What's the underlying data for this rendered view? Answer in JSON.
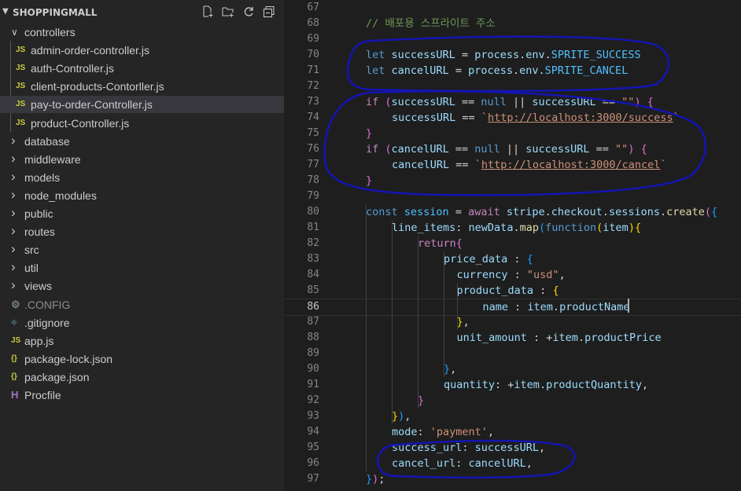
{
  "explorer": {
    "title": "SHOPPINGMALL",
    "header_icons": [
      "new-file-icon",
      "new-folder-icon",
      "refresh-icon",
      "collapse-all-icon"
    ],
    "items": [
      {
        "label": "controllers",
        "kind": "folder-open",
        "depth": 0
      },
      {
        "label": "admin-order-controller.js",
        "kind": "js",
        "depth": 1
      },
      {
        "label": "auth-Controller.js",
        "kind": "js",
        "depth": 1
      },
      {
        "label": "client-products-Contorller.js",
        "kind": "js",
        "depth": 1
      },
      {
        "label": "pay-to-order-Controller.js",
        "kind": "js",
        "depth": 1,
        "selected": true
      },
      {
        "label": "product-Controller.js",
        "kind": "js",
        "depth": 1
      },
      {
        "label": "database",
        "kind": "folder",
        "depth": 0
      },
      {
        "label": "middleware",
        "kind": "folder",
        "depth": 0
      },
      {
        "label": "models",
        "kind": "folder",
        "depth": 0
      },
      {
        "label": "node_modules",
        "kind": "folder",
        "depth": 0
      },
      {
        "label": "public",
        "kind": "folder",
        "depth": 0
      },
      {
        "label": "routes",
        "kind": "folder",
        "depth": 0
      },
      {
        "label": "src",
        "kind": "folder",
        "depth": 0
      },
      {
        "label": "util",
        "kind": "folder",
        "depth": 0
      },
      {
        "label": "views",
        "kind": "folder",
        "depth": 0
      },
      {
        "label": ".CONFIG",
        "kind": "gear",
        "depth": 0,
        "dim": true
      },
      {
        "label": ".gitignore",
        "kind": "git",
        "depth": 0
      },
      {
        "label": "app.js",
        "kind": "js",
        "depth": 0
      },
      {
        "label": "package-lock.json",
        "kind": "json",
        "depth": 0
      },
      {
        "label": "package.json",
        "kind": "json",
        "depth": 0
      },
      {
        "label": "Procfile",
        "kind": "heroku",
        "depth": 0
      }
    ]
  },
  "editor": {
    "current_line": 86,
    "lines": [
      {
        "n": "67",
        "indent": 0,
        "tokens": []
      },
      {
        "n": "68",
        "indent": 1,
        "tokens": [
          [
            "cmt",
            "// 배포용 스프라이트 주소"
          ]
        ]
      },
      {
        "n": "69",
        "indent": 0,
        "tokens": []
      },
      {
        "n": "70",
        "indent": 1,
        "tokens": [
          [
            "kw",
            "let"
          ],
          [
            "pl",
            " "
          ],
          [
            "var",
            "successURL"
          ],
          [
            "pl",
            " = "
          ],
          [
            "var",
            "process"
          ],
          [
            "pl",
            "."
          ],
          [
            "var",
            "env"
          ],
          [
            "pl",
            "."
          ],
          [
            "const",
            "SPRITE_SUCCESS"
          ]
        ]
      },
      {
        "n": "71",
        "indent": 1,
        "tokens": [
          [
            "kw",
            "let"
          ],
          [
            "pl",
            " "
          ],
          [
            "var",
            "cancelURL"
          ],
          [
            "pl",
            " = "
          ],
          [
            "var",
            "process"
          ],
          [
            "pl",
            "."
          ],
          [
            "var",
            "env"
          ],
          [
            "pl",
            "."
          ],
          [
            "const",
            "SPRITE_CANCEL"
          ]
        ]
      },
      {
        "n": "72",
        "indent": 0,
        "tokens": []
      },
      {
        "n": "73",
        "indent": 1,
        "tokens": [
          [
            "kw2",
            "if"
          ],
          [
            "pl",
            " "
          ],
          [
            "br2",
            "("
          ],
          [
            "var",
            "successURL"
          ],
          [
            "pl",
            " == "
          ],
          [
            "kw",
            "null"
          ],
          [
            "pl",
            " || "
          ],
          [
            "var",
            "successURL"
          ],
          [
            "pl",
            " == "
          ],
          [
            "str",
            "\"\""
          ],
          [
            "br2",
            ")"
          ],
          [
            "pl",
            " "
          ],
          [
            "br2",
            "{"
          ]
        ]
      },
      {
        "n": "74",
        "indent": 2,
        "tokens": [
          [
            "var",
            "successURL"
          ],
          [
            "pl",
            " == "
          ],
          [
            "str",
            "`"
          ],
          [
            "url",
            "http://localhost:3000/success"
          ],
          [
            "str",
            "`"
          ]
        ]
      },
      {
        "n": "75",
        "indent": 1,
        "tokens": [
          [
            "br2",
            "}"
          ]
        ]
      },
      {
        "n": "76",
        "indent": 1,
        "tokens": [
          [
            "kw2",
            "if"
          ],
          [
            "pl",
            " "
          ],
          [
            "br2",
            "("
          ],
          [
            "var",
            "cancelURL"
          ],
          [
            "pl",
            " == "
          ],
          [
            "kw",
            "null"
          ],
          [
            "pl",
            " || "
          ],
          [
            "var",
            "successURL"
          ],
          [
            "pl",
            " == "
          ],
          [
            "str",
            "\"\""
          ],
          [
            "br2",
            ")"
          ],
          [
            "pl",
            " "
          ],
          [
            "br2",
            "{"
          ]
        ]
      },
      {
        "n": "77",
        "indent": 2,
        "tokens": [
          [
            "var",
            "cancelURL"
          ],
          [
            "pl",
            " == "
          ],
          [
            "str",
            "`"
          ],
          [
            "url",
            "http://localhost:3000/cancel"
          ],
          [
            "str",
            "`"
          ]
        ]
      },
      {
        "n": "78",
        "indent": 1,
        "tokens": [
          [
            "br2",
            "}"
          ]
        ]
      },
      {
        "n": "79",
        "indent": 0,
        "tokens": []
      },
      {
        "n": "80",
        "indent": 1,
        "tokens": [
          [
            "kw",
            "const"
          ],
          [
            "pl",
            " "
          ],
          [
            "const",
            "session"
          ],
          [
            "pl",
            " = "
          ],
          [
            "kw2",
            "await"
          ],
          [
            "pl",
            " "
          ],
          [
            "var",
            "stripe"
          ],
          [
            "pl",
            "."
          ],
          [
            "var",
            "checkout"
          ],
          [
            "pl",
            "."
          ],
          [
            "var",
            "sessions"
          ],
          [
            "pl",
            "."
          ],
          [
            "fn",
            "create"
          ],
          [
            "br2",
            "("
          ],
          [
            "br3",
            "{"
          ]
        ]
      },
      {
        "n": "81",
        "indent": 2,
        "tokens": [
          [
            "var",
            "line_items"
          ],
          [
            "pl",
            ": "
          ],
          [
            "var",
            "newData"
          ],
          [
            "pl",
            "."
          ],
          [
            "fn",
            "map"
          ],
          [
            "br3",
            "("
          ],
          [
            "kw",
            "function"
          ],
          [
            "br1",
            "("
          ],
          [
            "var",
            "item"
          ],
          [
            "br1",
            ")"
          ],
          [
            "br1",
            "{"
          ]
        ]
      },
      {
        "n": "82",
        "indent": 3,
        "tokens": [
          [
            "kw2",
            "return"
          ],
          [
            "br2",
            "{"
          ]
        ]
      },
      {
        "n": "83",
        "indent": 4,
        "tokens": [
          [
            "var",
            "price_data"
          ],
          [
            "pl",
            " : "
          ],
          [
            "br3",
            "{"
          ]
        ]
      },
      {
        "n": "84",
        "indent": 4.5,
        "tokens": [
          [
            "var",
            "currency"
          ],
          [
            "pl",
            " : "
          ],
          [
            "str",
            "\"usd\""
          ],
          [
            "pl",
            ","
          ]
        ]
      },
      {
        "n": "85",
        "indent": 4.5,
        "tokens": [
          [
            "var",
            "product_data"
          ],
          [
            "pl",
            " : "
          ],
          [
            "br1",
            "{"
          ]
        ]
      },
      {
        "n": "86",
        "indent": 5.5,
        "tokens": [
          [
            "var",
            "name"
          ],
          [
            "pl",
            " : "
          ],
          [
            "var",
            "item"
          ],
          [
            "pl",
            "."
          ],
          [
            "var",
            "productName"
          ]
        ]
      },
      {
        "n": "87",
        "indent": 4.5,
        "tokens": [
          [
            "br1",
            "}"
          ],
          [
            "pl",
            ","
          ]
        ]
      },
      {
        "n": "88",
        "indent": 4.5,
        "tokens": [
          [
            "var",
            "unit_amount"
          ],
          [
            "pl",
            " : +"
          ],
          [
            "var",
            "item"
          ],
          [
            "pl",
            "."
          ],
          [
            "var",
            "productPrice"
          ]
        ]
      },
      {
        "n": "89",
        "indent": 0,
        "tokens": []
      },
      {
        "n": "90",
        "indent": 4,
        "tokens": [
          [
            "br3",
            "}"
          ],
          [
            "pl",
            ","
          ]
        ]
      },
      {
        "n": "91",
        "indent": 4,
        "tokens": [
          [
            "var",
            "quantity"
          ],
          [
            "pl",
            ": +"
          ],
          [
            "var",
            "item"
          ],
          [
            "pl",
            "."
          ],
          [
            "var",
            "productQuantity"
          ],
          [
            "pl",
            ","
          ]
        ]
      },
      {
        "n": "92",
        "indent": 3,
        "tokens": [
          [
            "br2",
            "}"
          ]
        ]
      },
      {
        "n": "93",
        "indent": 2,
        "tokens": [
          [
            "br1",
            "}"
          ],
          [
            "br3",
            ")"
          ],
          [
            "pl",
            ","
          ]
        ]
      },
      {
        "n": "94",
        "indent": 2,
        "tokens": [
          [
            "var",
            "mode"
          ],
          [
            "pl",
            ": "
          ],
          [
            "str",
            "'payment'"
          ],
          [
            "pl",
            ","
          ]
        ]
      },
      {
        "n": "95",
        "indent": 2,
        "tokens": [
          [
            "var",
            "success_url"
          ],
          [
            "pl",
            ": "
          ],
          [
            "var",
            "successURL"
          ],
          [
            "pl",
            ","
          ]
        ]
      },
      {
        "n": "96",
        "indent": 2,
        "tokens": [
          [
            "var",
            "cancel_url"
          ],
          [
            "pl",
            ": "
          ],
          [
            "var",
            "cancelURL"
          ],
          [
            "pl",
            ","
          ]
        ]
      },
      {
        "n": "97",
        "indent": 1,
        "tokens": [
          [
            "br3",
            "}"
          ],
          [
            "br2",
            ")"
          ],
          [
            "pl",
            ";"
          ]
        ]
      }
    ]
  },
  "colors": {
    "annotation": "#1010c0",
    "selected_row": "#37373d"
  }
}
